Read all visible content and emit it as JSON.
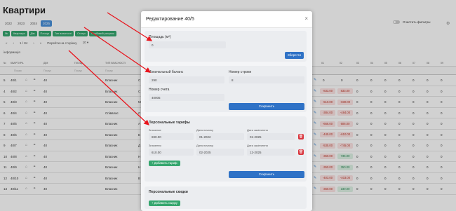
{
  "page": {
    "title": "Квартири"
  },
  "years": [
    "2022",
    "2023",
    "2024",
    "2025"
  ],
  "active_year": "2025",
  "filter_chips": [
    "№",
    "Квартира",
    "Дім",
    "Площа",
    "Тип власності",
    "Статус",
    "Особовий рахунок"
  ],
  "pager": {
    "first": "«",
    "prev": "‹",
    "page": "1 / 84",
    "next": "›",
    "last": "»",
    "goto": "Перейти на сторінку",
    "per_page": "10 ▾"
  },
  "info_tab": "інформація",
  "clear_filters": "Очистить фильтры",
  "table": {
    "headers": [
      "№",
      "КВАРТИРА",
      "ДІМ",
      "ПЛОЩ",
      "ТИП ВЛАСНОСТІ",
      "",
      "01",
      "02",
      "03",
      "04",
      "05",
      "06",
      "07",
      "08",
      "09"
    ],
    "subheaders": [
      "",
      "Пошук",
      "Пошук",
      "Пошук",
      "Пошук"
    ],
    "rows": [
      {
        "num": "5",
        "apt": "40/1",
        "house": "40",
        "type": "Власник",
        "b": "С",
        "v1": "0",
        "v2": "0",
        "rest": [
          "0",
          "0",
          "0",
          "0",
          "0",
          "0",
          "0"
        ],
        "c1": "plain",
        "c2": "plain"
      },
      {
        "num": "4",
        "apt": "40/2",
        "house": "40",
        "type": "Власник",
        "b": "С",
        "v1": "-833.00",
        "v2": "833.00",
        "rest": [
          "0",
          "0",
          "0",
          "0",
          "0",
          "0",
          "0"
        ],
        "c1": "red",
        "c2": "red"
      },
      {
        "num": "5",
        "apt": "40/3",
        "house": "40",
        "type": "Власник",
        "b": "М",
        "v1": "-510.00",
        "v2": "-830.00",
        "rest": [
          "0",
          "0",
          "0",
          "0",
          "0",
          "0",
          "0"
        ],
        "c1": "red",
        "c2": "red"
      },
      {
        "num": "6",
        "apt": "40/4",
        "house": "40",
        "type": "Співвлас",
        "b": "С",
        "v1": "-384.00",
        "v2": "-484.00",
        "rest": [
          "0",
          "0",
          "0",
          "0",
          "0",
          "0",
          "0"
        ],
        "c1": "red",
        "c2": "red"
      },
      {
        "num": "7",
        "apt": "40/5",
        "house": "40",
        "type": "Власник",
        "b": "А",
        "v1": "-666.00",
        "v2": "606.00",
        "rest": [
          "0",
          "0",
          "0",
          "0",
          "0",
          "0",
          "0"
        ],
        "c1": "red",
        "c2": "red"
      },
      {
        "num": "8",
        "apt": "40/6",
        "house": "40",
        "type": "Власник",
        "b": "Е",
        "v1": "-445.00",
        "v2": "-610.00",
        "rest": [
          "0",
          "0",
          "0",
          "0",
          "0",
          "0",
          "0"
        ],
        "c1": "red",
        "c2": "red"
      },
      {
        "num": "9",
        "apt": "40/7",
        "house": "40",
        "type": "Власник",
        "b": "Д",
        "v1": "-535.00",
        "v2": "-745.00",
        "rest": [
          "0",
          "0",
          "0",
          "0",
          "0",
          "0",
          "0"
        ],
        "c1": "red",
        "c2": "red"
      },
      {
        "num": "10",
        "apt": "40/8",
        "house": "40",
        "type": "Власник",
        "b": "Н",
        "v1": "-350.00",
        "v2": "735.00",
        "rest": [
          "0",
          "0",
          "0",
          "0",
          "0",
          "0",
          "0"
        ],
        "c1": "red",
        "c2": "green"
      },
      {
        "num": "11",
        "apt": "40/9",
        "house": "40",
        "type": "Власник",
        "b": "Н",
        "v1": "-350.00",
        "v2": "350.00",
        "rest": [
          "0",
          "0",
          "0",
          "0",
          "0",
          "0",
          "0"
        ],
        "c1": "red",
        "c2": "green"
      },
      {
        "num": "12",
        "apt": "40/10",
        "house": "40",
        "type": "Власник",
        "b": "В",
        "v1": "-403.00",
        "v2": "-403.00",
        "rest": [
          "0",
          "0",
          "0",
          "0",
          "0",
          "0",
          "0"
        ],
        "c1": "red",
        "c2": "red"
      },
      {
        "num": "13",
        "apt": "40/11",
        "house": "40",
        "type": "Власник",
        "b": "",
        "v1": "-360.00",
        "v2": "230.00",
        "rest": [
          "0",
          "0",
          "0",
          "0",
          "0",
          "0",
          "0"
        ],
        "c1": "red",
        "c2": "green"
      }
    ]
  },
  "modal": {
    "title": "Редактирование 40/5",
    "close": "×",
    "area": {
      "label": "Площадь (м²)",
      "value": "0",
      "button": "Зберегти"
    },
    "balance": {
      "initial_label": "Изначальный баланс",
      "initial_value": "290",
      "row_label": "Номер строки",
      "row_value": "8",
      "account_label": "Номер счета",
      "account_value": "40005",
      "button": "Сохранить"
    },
    "tariffs": {
      "title": "Персональные тарифы",
      "items": [
        {
          "value_label": "Значение",
          "value": "690.00",
          "start_label": "Дата початку",
          "start": "01-2022",
          "end_label": "Дата закінчення",
          "end": "01-2025"
        },
        {
          "value_label": "Значення",
          "value": "610.00",
          "start_label": "Дата початку",
          "start": "02-2025",
          "end_label": "Дата закінчення",
          "end": "12-2025"
        }
      ],
      "add_button": "+ Добавить тариф",
      "save_button": "Сохранить"
    },
    "discounts": {
      "title": "Персональные скидки",
      "add_button": "+ Добавить скидку"
    }
  },
  "colors": {
    "accent": "#2f72c6",
    "green": "#35a66e",
    "danger": "#d9363e",
    "arrow": "#e8141c"
  }
}
